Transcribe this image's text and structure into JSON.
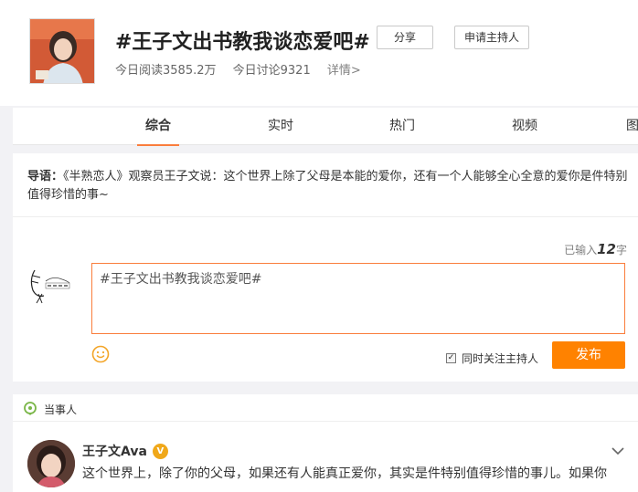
{
  "topic": {
    "title": "#王子文出书教我谈恋爱吧#",
    "share_label": "分享",
    "apply_host_label": "申请主持人",
    "reads": "今日阅读3585.2万",
    "discussions": "今日讨论9321",
    "details": "详情>"
  },
  "tabs": [
    {
      "label": "综合",
      "active": true
    },
    {
      "label": "实时",
      "active": false
    },
    {
      "label": "热门",
      "active": false
    },
    {
      "label": "视频",
      "active": false
    },
    {
      "label": "图",
      "active": false
    }
  ],
  "intro": {
    "prefix": "导语：",
    "text": "《半熟恋人》观察员王子文说：这个世界上除了父母是本能的爱你，还有一个人能够全心全意的爱你是件特别值得珍惜的事~"
  },
  "composer": {
    "count_prefix": "已输入",
    "count": "12",
    "count_suffix": "字",
    "value": "#王子文出书教我谈恋爱吧#",
    "follow_label": "同时关注主持人",
    "follow_checked": true,
    "publish_label": "发布",
    "accent": "#fa7d3c",
    "button_color": "#ff8200"
  },
  "people": {
    "section_label": "当事人",
    "name": "王子文Ava",
    "text": "这个世界上，除了你的父母，如果还有人能真正爱你，其实是件特别值得珍惜的事儿。如果你"
  }
}
